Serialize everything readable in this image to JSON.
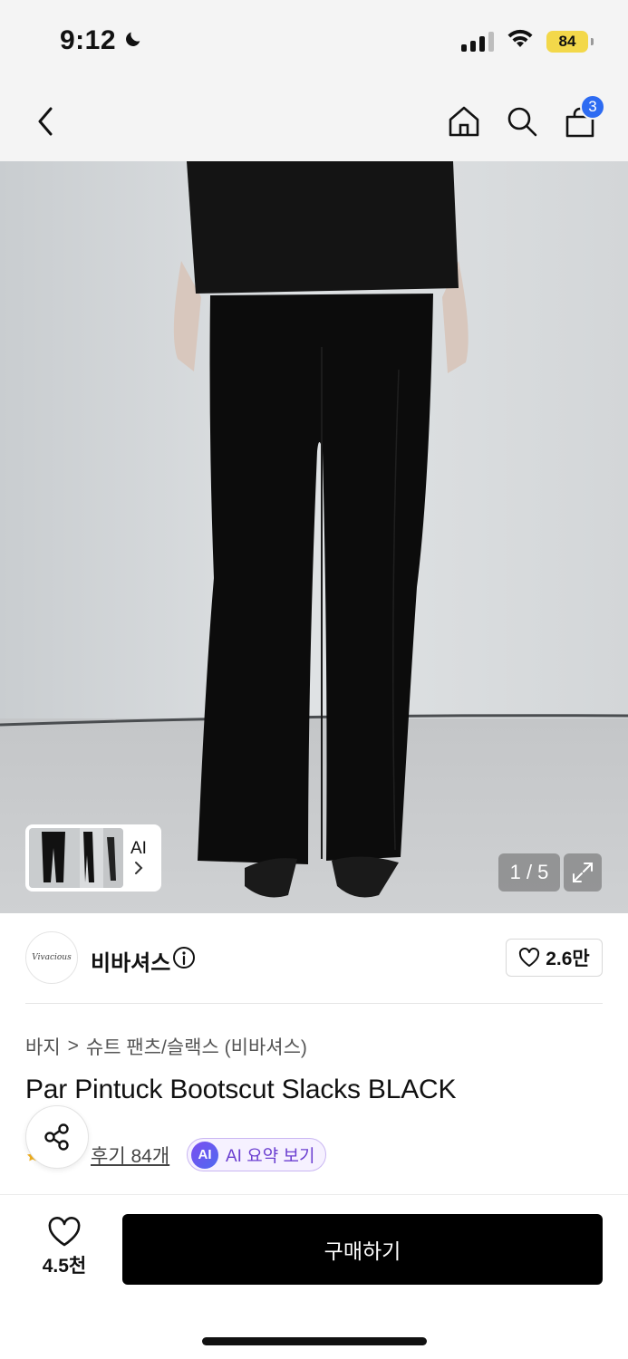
{
  "status_bar": {
    "time": "9:12",
    "battery": "84",
    "moon_icon": "moon-icon",
    "signal_icon": "cellular-signal-icon",
    "wifi_icon": "wifi-icon"
  },
  "nav": {
    "back_icon": "chevron-left-icon",
    "home_icon": "home-icon",
    "search_icon": "search-icon",
    "cart_icon": "shopping-bag-icon",
    "cart_count": "3"
  },
  "gallery": {
    "ai_label": "AI",
    "counter": "1 / 5",
    "expand_icon": "expand-icon"
  },
  "brand": {
    "logo_text": "Vivacious",
    "name": "비바셔스",
    "like_count": "2.6만"
  },
  "breadcrumb": {
    "category": "바지",
    "separator": ">",
    "subcategory": "슈트 팬츠/슬랙스 (비바셔스)"
  },
  "product": {
    "title": "Par Pintuck Bootscut Slacks BLACK",
    "review_link": "후기 84개",
    "ai_badge": "AI",
    "ai_summary": "AI 요약 보기"
  },
  "bottom_bar": {
    "wish_count": "4.5천",
    "buy_label": "구매하기"
  },
  "colors": {
    "accent_blue": "#2d6bf2",
    "ai_purple": "#6b3fd0",
    "buy_button": "#000000",
    "battery_yellow": "#f3d84a"
  }
}
